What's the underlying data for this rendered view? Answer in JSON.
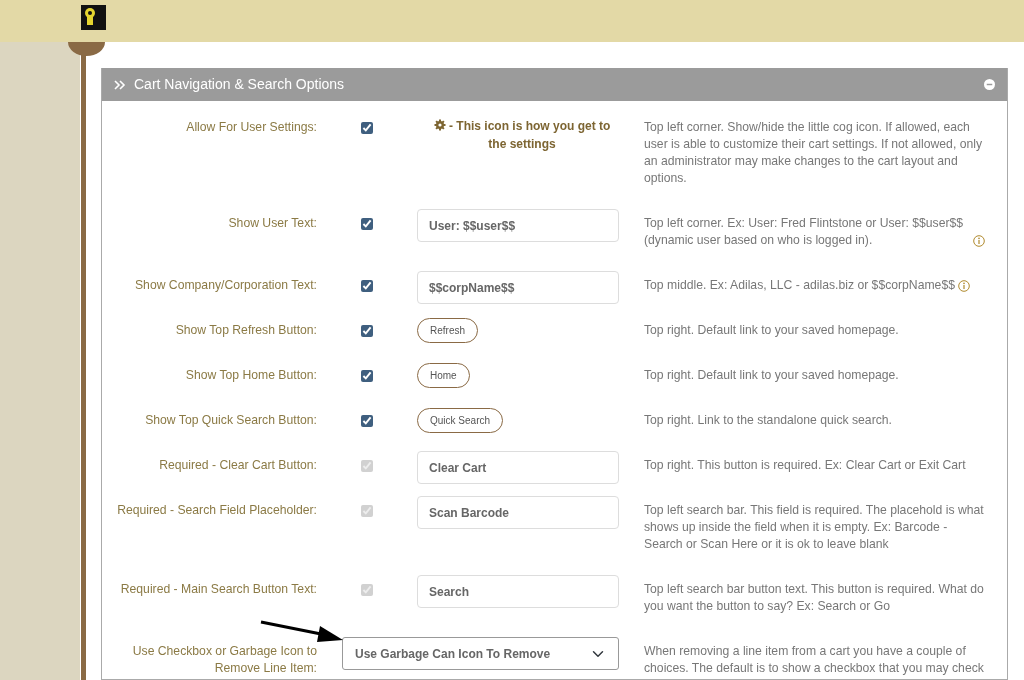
{
  "panel": {
    "title": "Cart Navigation & Search Options",
    "expanded": true
  },
  "rows": [
    {
      "kind": "note",
      "label": "Allow For User Settings:",
      "checked": true,
      "disabled": false,
      "note": "- This icon is how you get to the settings",
      "description": "Top left corner. Show/hide the little cog icon. If allowed, each user is able to customize their cart settings. If not allowed, only an administrator may make changes to the cart layout and options.",
      "info": false
    },
    {
      "kind": "field",
      "label": "Show User Text:",
      "checked": true,
      "disabled": false,
      "value": "User: $$user$$",
      "description": "Top left corner. Ex: User: Fred Flintstone or User: $$user$$ (dynamic user based on who is logged in).",
      "info": true
    },
    {
      "kind": "field",
      "label": "Show Company/Corporation Text:",
      "checked": true,
      "disabled": false,
      "value": "$$corpName$$",
      "description": "Top middle. Ex: Adilas, LLC - adilas.biz or $$corpName$$",
      "info": true
    },
    {
      "kind": "button",
      "label": "Show Top Refresh Button:",
      "checked": true,
      "disabled": false,
      "value": "Refresh",
      "description": "Top right. Default link to your saved homepage.",
      "info": false
    },
    {
      "kind": "button",
      "label": "Show Top Home Button:",
      "checked": true,
      "disabled": false,
      "value": "Home",
      "description": "Top right. Default link to your saved homepage.",
      "info": false
    },
    {
      "kind": "button",
      "label": "Show Top Quick Search Button:",
      "checked": true,
      "disabled": false,
      "value": "Quick Search",
      "description": "Top right. Link to the standalone quick search.",
      "info": false
    },
    {
      "kind": "field",
      "label": "Required - Clear Cart Button:",
      "checked": true,
      "disabled": true,
      "value": "Clear Cart",
      "description": "Top right. This button is required. Ex: Clear Cart or Exit Cart",
      "info": false
    },
    {
      "kind": "field",
      "label": "Required - Search Field Placeholder:",
      "checked": true,
      "disabled": true,
      "value": "Scan Barcode",
      "description": "Top left search bar. This field is required. The placehold is what shows up inside the field when it is empty. Ex: Barcode - Search or Scan Here or it is ok to leave blank",
      "info": false
    },
    {
      "kind": "field",
      "label": "Required - Main Search Button Text:",
      "checked": true,
      "disabled": true,
      "value": "Search",
      "description": "Top left search bar button text. This button is required. What do you want the button to say? Ex: Search or Go",
      "info": false
    },
    {
      "kind": "select",
      "label": "Use Checkbox or Garbage Icon to Remove Line Item:",
      "value": "Use Garbage Can Icon To Remove",
      "description": "When removing a line item from a cart you have a couple of choices. The default is to show a checkbox that you may check",
      "info": false
    }
  ]
}
